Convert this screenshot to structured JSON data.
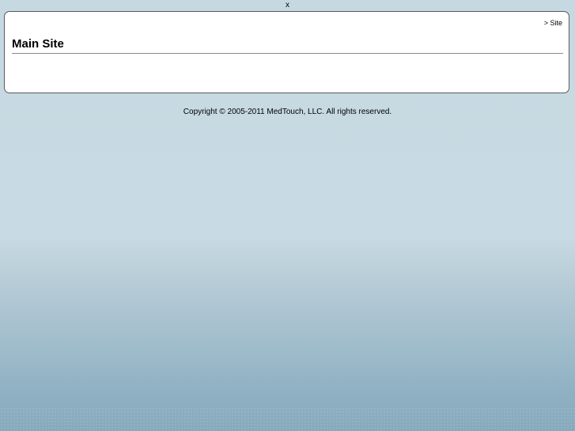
{
  "window": {
    "close_label": "x"
  },
  "panel": {
    "breadcrumb": {
      "separator": ">",
      "link_label": "Site"
    },
    "title": "Main Site"
  },
  "footer": {
    "copyright": "Copyright © 2005-2011 MedTouch, LLC. All rights reserved."
  },
  "colors": {
    "background_top": "#c6d9e2",
    "background_bottom": "#86a9bc",
    "panel_bg": "#ffffff",
    "panel_border": "#5a5a5a"
  }
}
